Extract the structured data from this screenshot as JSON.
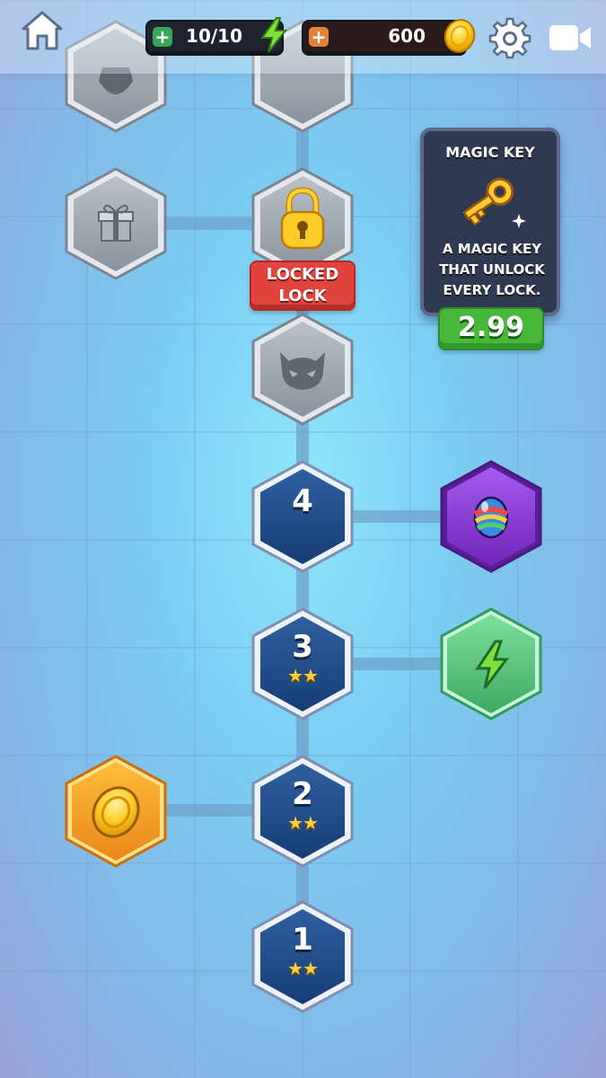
{
  "topbar": {
    "energy": {
      "value": "10/10",
      "plus_icon": "plus-icon",
      "icon": "lightning-icon"
    },
    "coins": {
      "value": "600",
      "plus_icon": "plus-icon",
      "icon": "coin-icon"
    },
    "home_icon": "home-icon",
    "settings_icon": "gear-icon",
    "video_icon": "video-camera-icon"
  },
  "nodes": {
    "top_left_partial": {
      "icon": "shield-icon",
      "state": "locked"
    },
    "top_center_partial": {
      "state": "locked"
    },
    "gift": {
      "icon": "gift-icon",
      "state": "locked"
    },
    "lock": {
      "icon": "padlock-icon",
      "state": "locked"
    },
    "boss": {
      "icon": "devil-skull-icon",
      "state": "locked"
    },
    "egg": {
      "icon": "rainbow-egg-icon",
      "color": "#8a3fd6"
    },
    "energy_reward": {
      "icon": "lightning-icon",
      "color": "#55c97a"
    },
    "coin_reward": {
      "icon": "coin-icon",
      "color": "#f2a223"
    }
  },
  "locked_label": {
    "line1": "LOCKED",
    "line2": "LOCK"
  },
  "levels": [
    {
      "number": "4",
      "stars": ""
    },
    {
      "number": "3",
      "stars": "★★"
    },
    {
      "number": "2",
      "stars": "★★"
    },
    {
      "number": "1",
      "stars": "★★"
    }
  ],
  "magic_key_offer": {
    "title": "MAGIC KEY",
    "description": "A MAGIC KEY THAT UNLOCK EVERY LOCK.",
    "price": "2.99",
    "icon": "golden-key-icon"
  },
  "colors": {
    "level_blue": "#1f4f8f",
    "locked_grey": "#9aa3ad",
    "price_green": "#47b83c",
    "locked_red": "#e0443e"
  }
}
